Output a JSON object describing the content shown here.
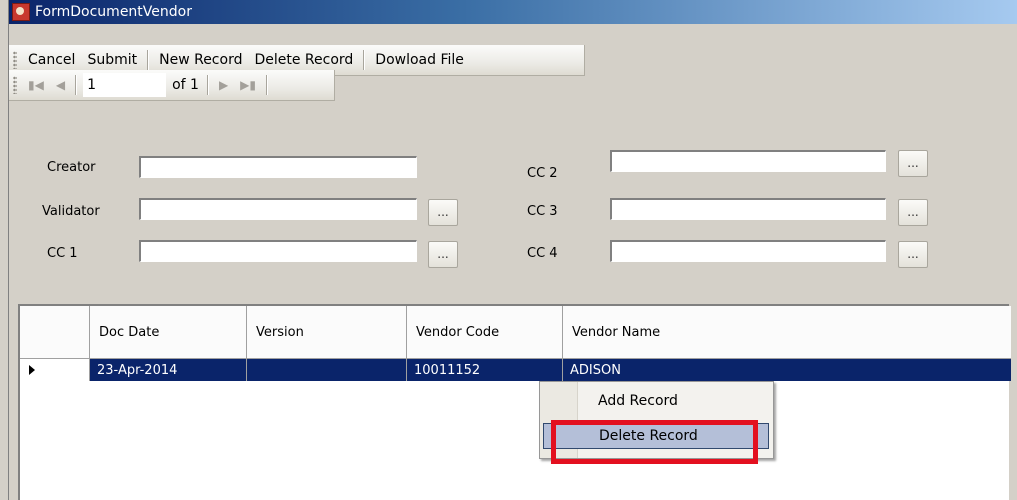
{
  "window": {
    "title": "FormDocumentVendor"
  },
  "toolbar": {
    "cancel": "Cancel",
    "submit": "Submit",
    "new_record": "New Record",
    "delete_record": "Delete Record",
    "download_file": "Dowload File"
  },
  "navigator": {
    "first_icon": "first-record-icon",
    "prev_icon": "previous-record-icon",
    "next_icon": "next-record-icon",
    "last_icon": "last-record-icon",
    "position": "1",
    "of_label": "of 1"
  },
  "form": {
    "creator_label": "Creator",
    "validator_label": "Validator",
    "cc1_label": "CC 1",
    "cc2_label": "CC 2",
    "cc3_label": "CC 3",
    "cc4_label": "CC 4",
    "ellipsis": "..."
  },
  "grid": {
    "columns": [
      "Doc Date",
      "Version",
      "Vendor Code",
      "Vendor Name"
    ],
    "rows": [
      {
        "doc_date": "23-Apr-2014",
        "version": "",
        "vendor_code": "10011152",
        "vendor_name": "ADISON",
        "selected": true
      }
    ]
  },
  "context_menu": {
    "items": [
      "Add Record",
      "Delete Record"
    ],
    "highlighted": "Delete Record"
  },
  "colors": {
    "selection": "#0a246a",
    "menu_highlight": "#b4bfd8",
    "annotation_box": "#e3101f"
  }
}
